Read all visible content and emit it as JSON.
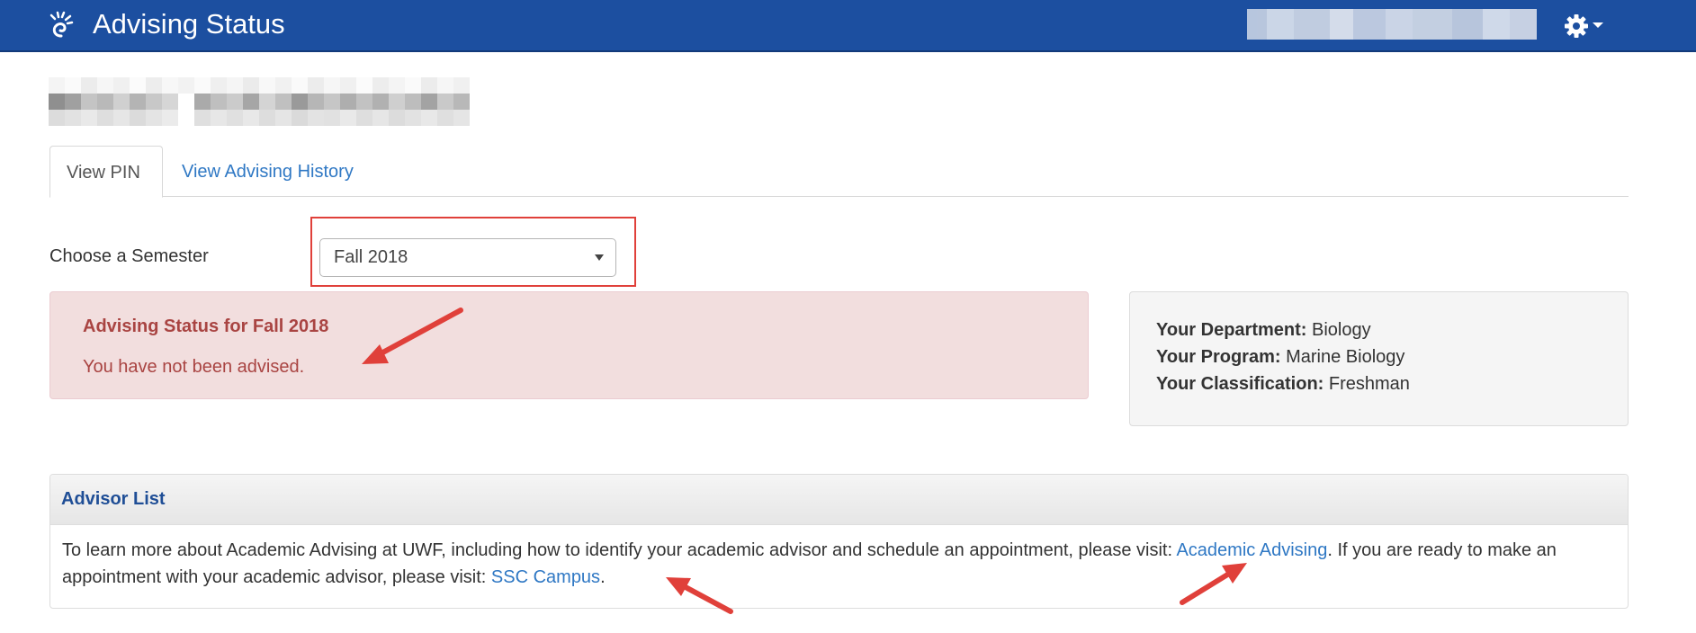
{
  "header": {
    "app_title": "Advising Status",
    "logo_icon": "spiral-logo-icon",
    "settings_icon": "gear-icon",
    "brand_color": "#1c4fa0"
  },
  "tabs": [
    {
      "label": "View PIN",
      "active": true
    },
    {
      "label": "View Advising History",
      "active": false
    }
  ],
  "semester": {
    "label": "Choose a Semester",
    "selected": "Fall 2018"
  },
  "alert": {
    "title": "Advising Status for Fall 2018",
    "message": "You have not been advised."
  },
  "student_info": {
    "department_label": "Your Department:",
    "department": "Biology",
    "program_label": "Your Program:",
    "program": "Marine Biology",
    "classification_label": "Your Classification:",
    "classification": "Freshman"
  },
  "advisor_panel": {
    "title": "Advisor List",
    "text_1": "To learn more about Academic Advising at UWF, including how to identify your academic advisor and schedule an appointment, please visit: ",
    "link_1": "Academic Advising",
    "text_2": ". If you are ready to make an appointment with your academic advisor, please visit: ",
    "link_2": "SSC Campus",
    "text_3": "."
  },
  "annotation_color": "#e0403a"
}
